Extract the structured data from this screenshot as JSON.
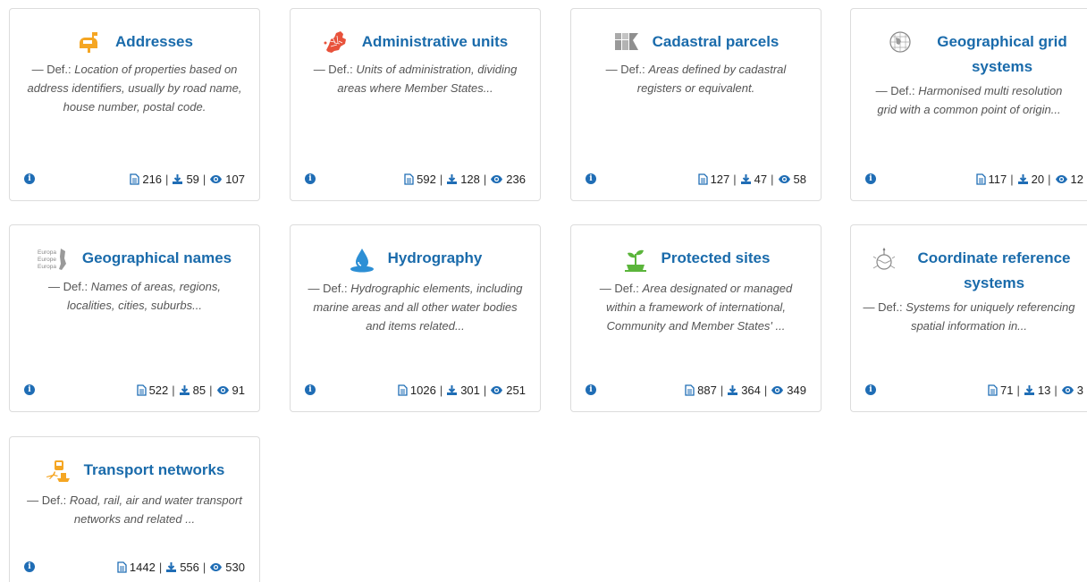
{
  "def_label": "— Def.:",
  "cards": [
    {
      "title": "Addresses",
      "def": "Location of properties based on address identifiers, usually by road name, house number, postal code.",
      "records": "216",
      "downloads": "59",
      "views": "107",
      "icon": "mailbox-icon"
    },
    {
      "title": "Administrative units",
      "def": "Units of administration, dividing areas where Member States...",
      "records": "592",
      "downloads": "128",
      "views": "236",
      "icon": "europe-map-icon"
    },
    {
      "title": "Cadastral parcels",
      "def": "Areas defined by cadastral registers or equivalent.",
      "records": "127",
      "downloads": "47",
      "views": "58",
      "icon": "parcels-icon"
    },
    {
      "title": "Geographical grid systems",
      "def": "Harmonised multi resolution grid with a common point of origin...",
      "records": "117",
      "downloads": "20",
      "views": "12",
      "icon": "grid-globe-icon"
    },
    {
      "title": "Geographical names",
      "def": "Names of areas, regions, localities, cities, suburbs...",
      "records": "522",
      "downloads": "85",
      "views": "91",
      "icon": "place-names-icon",
      "icon_text": [
        "Europa",
        "Europe",
        "Europa"
      ]
    },
    {
      "title": "Hydrography",
      "def": "Hydrographic elements, including marine areas and all other water bodies and items related...",
      "records": "1026",
      "downloads": "301",
      "views": "251",
      "icon": "water-drop-icon"
    },
    {
      "title": "Protected sites",
      "def": "Area designated or managed within a framework of international, Community and Member States' ...",
      "records": "887",
      "downloads": "364",
      "views": "349",
      "icon": "plant-icon"
    },
    {
      "title": "Coordinate reference systems",
      "def": "Systems for uniquely referencing spatial information in...",
      "records": "71",
      "downloads": "13",
      "views": "3",
      "icon": "compass-globe-icon"
    },
    {
      "title": "Transport networks",
      "def": "Road, rail, air and water transport networks and related ...",
      "records": "1442",
      "downloads": "556",
      "views": "530",
      "icon": "transport-icon"
    }
  ],
  "colors": {
    "title": "#1a6bab",
    "icon_blue": "#1f6db5",
    "addresses_orange": "#f5a623",
    "admin_red": "#e8523b",
    "hydro_blue": "#2d8fd5",
    "protected_green": "#5bb53b"
  }
}
